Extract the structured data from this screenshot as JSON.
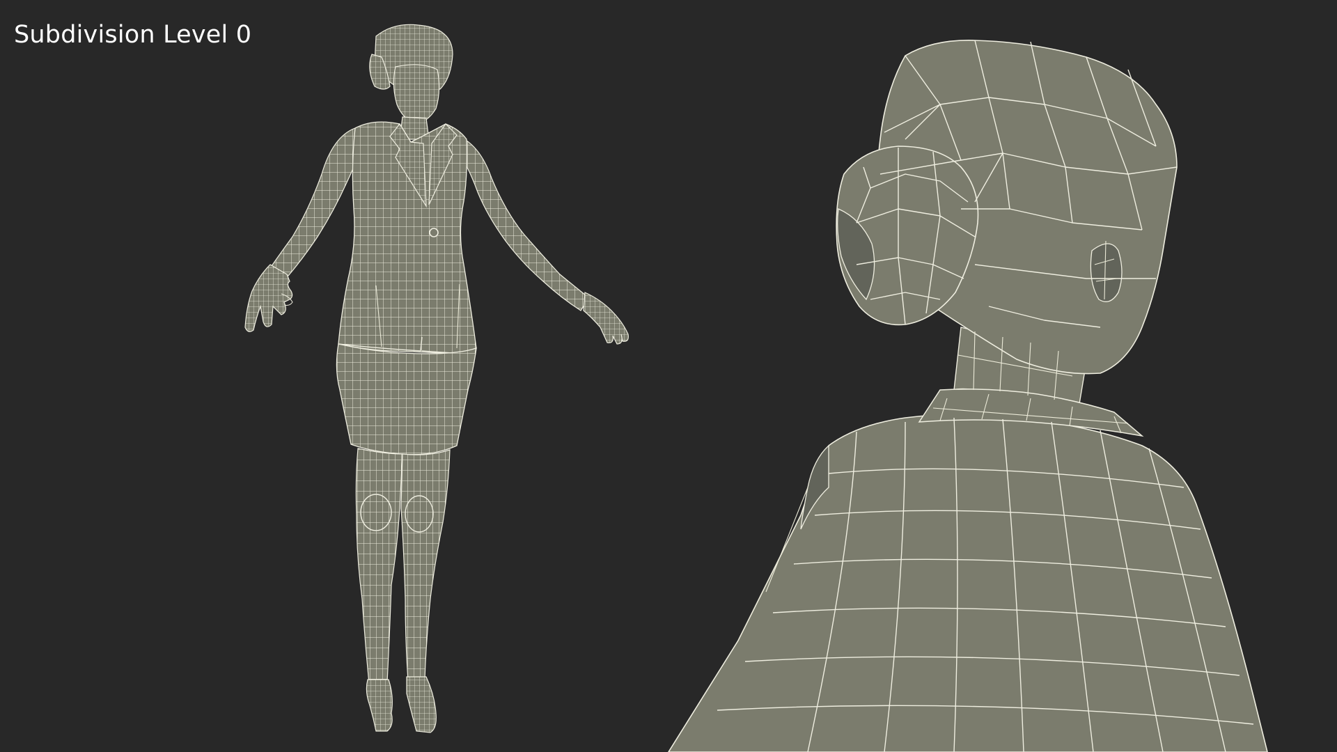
{
  "viewport": {
    "caption": "Subdivision Level 0",
    "background_color": "#282828",
    "mesh_color": "#7b7c6d",
    "wire_color": "#efeee0"
  },
  "scene": {
    "full_body_view": {
      "icon": "wireframe-figure"
    },
    "closeup_view": {
      "icon": "wireframe-head-closeup"
    }
  }
}
